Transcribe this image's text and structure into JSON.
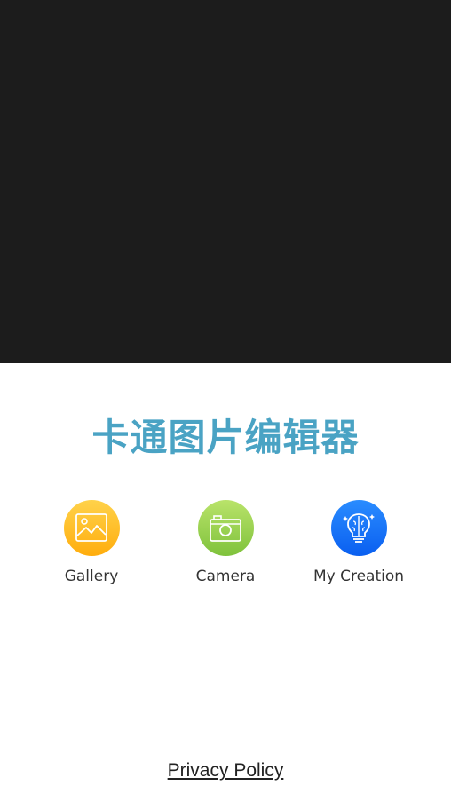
{
  "app": {
    "title": "卡通图片编辑器"
  },
  "actions": [
    {
      "label": "Gallery",
      "icon": "image-icon",
      "color_top": "#ffd24a",
      "color_bottom": "#ffad0d"
    },
    {
      "label": "Camera",
      "icon": "camera-icon",
      "color_top": "#b9e36a",
      "color_bottom": "#7fc23c"
    },
    {
      "label": "My Creation",
      "icon": "brain-bulb-icon",
      "color_top": "#2a8cff",
      "color_bottom": "#0a5ff0"
    }
  ],
  "footer": {
    "privacy_label": "Privacy Policy"
  },
  "colors": {
    "banner_bg": "#1c1c1c",
    "title": "#4aa3c4"
  }
}
